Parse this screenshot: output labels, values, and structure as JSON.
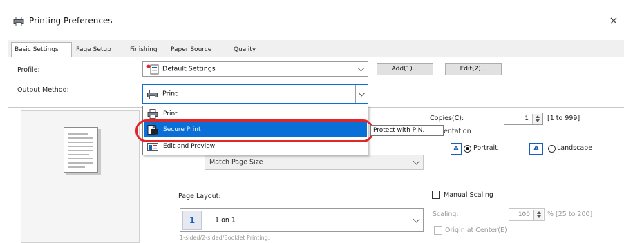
{
  "window": {
    "title": "Printing Preferences",
    "close_glyph": "×"
  },
  "tabs": [
    {
      "label": "Basic Settings"
    },
    {
      "label": "Page Setup"
    },
    {
      "label": "Finishing"
    },
    {
      "label": "Paper Source"
    },
    {
      "label": "Quality"
    }
  ],
  "profile": {
    "label": "Profile:",
    "value": "Default Settings",
    "add_label": "Add(1)...",
    "edit_label": "Edit(2)..."
  },
  "output_method": {
    "label": "Output Method:",
    "value": "Print",
    "options": [
      {
        "label": "Print",
        "icon": "printer-icon"
      },
      {
        "label": "Secure Print",
        "icon": "secure-print-icon"
      },
      {
        "label": "Edit and Preview",
        "icon": "edit-preview-icon"
      }
    ],
    "tooltip": "Protect with PIN."
  },
  "page_size": {
    "value": "Match Page Size"
  },
  "copies": {
    "label": "Copies(C):",
    "value": "1",
    "range": "[1 to 999]"
  },
  "orientation": {
    "label": "Orientation",
    "portrait_label": "Portrait",
    "landscape_label": "Landscape",
    "selected": "portrait"
  },
  "page_layout": {
    "label": "Page Layout:",
    "value": "1 on 1",
    "icon_text": "1",
    "next_label": "1-sided/2-sided/Booklet Printing:"
  },
  "manual_scaling": {
    "label": "Manual Scaling",
    "scaling_label": "Scaling:",
    "scaling_value": "100",
    "scaling_range": "% [25 to 200]",
    "origin_label": "Origin at Center(E)"
  }
}
